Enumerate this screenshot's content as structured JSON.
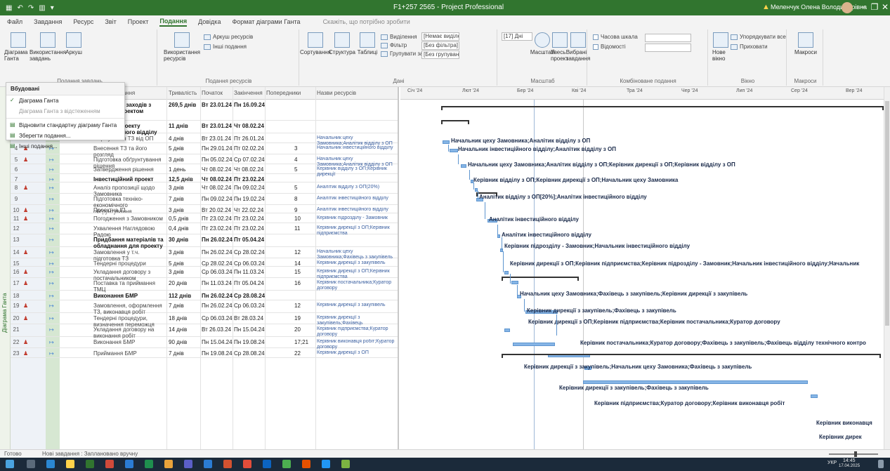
{
  "window": {
    "title": "F1+257 2565 - Project Professional",
    "user": "Меленчук Олена Володимирівна",
    "minimize": "−",
    "restore": "❐",
    "close": "✕"
  },
  "quick_access": [
    "▦",
    "↶",
    "↷",
    "▥",
    "▾"
  ],
  "tabs": [
    {
      "label": "Файл"
    },
    {
      "label": "Завдання"
    },
    {
      "label": "Ресурс"
    },
    {
      "label": "Звіт"
    },
    {
      "label": "Проект"
    },
    {
      "label": "Подання",
      "active": true
    },
    {
      "label": "Довідка"
    },
    {
      "label": "Формат діаграми Ганта"
    }
  ],
  "search_placeholder": "Скажіть, що потрібно зробити",
  "ribbon": {
    "groups": [
      {
        "label": "Подання завдань",
        "buttons": [
          "Діаграма Ганта",
          "Використання завдань",
          "Аркуш"
        ]
      },
      {
        "label": "Подання ресурсів",
        "buttons": [
          "Використання ресурсів",
          "Аркуш ресурсів",
          "Інші подання"
        ]
      },
      {
        "label": "Дані",
        "buttons": [
          "Сортування",
          "Структура",
          "Таблиці",
          "Виділення",
          "Фільтр",
          "Групувати за"
        ]
      },
      {
        "label": "Масштаб",
        "buttons": [
          "Масштаб",
          "Увесь проект",
          "Вибрані завдання"
        ]
      },
      {
        "label": "Комбіноване подання",
        "buttons": [
          "Часова шкала",
          "Відомості"
        ]
      },
      {
        "label": "Вікно",
        "buttons": [
          "Нове вікно",
          "Упорядкувати все",
          "Приховати"
        ]
      },
      {
        "label": "Макроси",
        "buttons": [
          "Макроси"
        ]
      }
    ],
    "combos": {
      "highlight": "[Немає виділення]",
      "filter": "[Без фільтра]",
      "group": "[Без групування]",
      "timescale": "[17] Дні"
    }
  },
  "dropdown": {
    "header": "Вбудовані",
    "items": [
      {
        "label": "Діаграма Ганта",
        "checked": true
      },
      {
        "label": "Діаграма Ганта з відстеженням",
        "muted": true
      },
      {
        "label": "Відновити стандартну діаграму Ганта"
      },
      {
        "label": "Зберегти подання..."
      },
      {
        "label": "Інші подання..."
      }
    ]
  },
  "side_label": "Діаграма Ганта",
  "grid": {
    "columns": [
      "Назва завдання",
      "Тривалість",
      "Початок",
      "Закінчення",
      "Попередники",
      "Назви ресурсів"
    ],
    "rows": [
      {
        "num": "",
        "name": "Тривалість заходів з робіт за проектом",
        "dur": "269,5 днів",
        "start": "Вт 23.01.24",
        "fin": "Пн 16.09.24",
        "pred": "",
        "res": "",
        "summary": true
      },
      {
        "num": "",
        "name": "Ініціація проекту інвестиційного відділу",
        "dur": "11 днів",
        "start": "Вт 23.01.24",
        "fin": "Чт 08.02.24",
        "pred": "",
        "res": "",
        "summary": true
      },
      {
        "num": "",
        "name": "Формування ТЗ від ОП",
        "dur": "4 днів",
        "start": "Вт 23.01.24",
        "fin": "Пт 26.01.24",
        "pred": "",
        "res": "Начальник цеху Замовника;Аналітик відділу з ОП",
        "summary": false
      },
      {
        "num": "4",
        "name": "Внесення ТЗ та його розгляд",
        "dur": "5 днів",
        "start": "Пн 29.01.24",
        "fin": "Пт 02.02.24",
        "pred": "3",
        "res": "Начальник інвестиційного відділу",
        "summary": false
      },
      {
        "num": "5",
        "name": "Підготовка обґрунтування рішення",
        "dur": "3 днів",
        "start": "Пн 05.02.24",
        "fin": "Ср 07.02.24",
        "pred": "4",
        "res": "Начальник цеху Замовника;Аналітик відділу з ОП",
        "summary": false
      },
      {
        "num": "6",
        "name": "Затвердження рішення",
        "dur": "1 день",
        "start": "Чт 08.02.24",
        "fin": "Чт 08.02.24",
        "pred": "5",
        "res": "Керівник відділу з ОП;Керівник дирекції",
        "summary": false
      },
      {
        "num": "7",
        "name": "Інвестиційний проект",
        "dur": "12,5 днів",
        "start": "Чт 08.02.24",
        "fin": "Пт 23.02.24",
        "pred": "",
        "res": "",
        "summary": true
      },
      {
        "num": "8",
        "name": "Аналіз пропозиції щодо Замовника",
        "dur": "3 днів",
        "start": "Чт 08.02.24",
        "fin": "Пн 09.02.24",
        "pred": "5",
        "res": "Аналітик відділу з ОП(20%)",
        "summary": false
      },
      {
        "num": "9",
        "name": "Підготовка техніко-економічного обґрунтування",
        "dur": "7 днів",
        "start": "Пн 09.02.24",
        "fin": "Пн 19.02.24",
        "pred": "8",
        "res": "Аналітик інвестиційного відділу",
        "summary": false
      },
      {
        "num": "10",
        "name": "Проектна ІП",
        "dur": "3 днів",
        "start": "Вт 20.02.24",
        "fin": "Чт 22.02.24",
        "pred": "9",
        "res": "Аналітик інвестиційного відділу",
        "summary": false
      },
      {
        "num": "11",
        "name": "Погодження з Замовником",
        "dur": "0,5 днів",
        "start": "Пт 23.02.24",
        "fin": "Пт 23.02.24",
        "pred": "10",
        "res": "Керівник підрозділу - Замовник",
        "summary": false
      },
      {
        "num": "12",
        "name": "Ухвалення Наглядовою Радою",
        "dur": "0,4 днів",
        "start": "Пт 23.02.24",
        "fin": "Пт 23.02.24",
        "pred": "11",
        "res": "Керівник дирекції з ОП;Керівник підприємства",
        "summary": false
      },
      {
        "num": "13",
        "name": "Придбання матеріалів та обладнання для проекту",
        "dur": "30 днів",
        "start": "Пн 26.02.24",
        "fin": "Пт 05.04.24",
        "pred": "",
        "res": "",
        "summary": true
      },
      {
        "num": "14",
        "name": "Замовлення у т.ч. підготовка ТЗ",
        "dur": "3 днів",
        "start": "Пн 26.02.24",
        "fin": "Ср 28.02.24",
        "pred": "12",
        "res": "Начальник цеху Замовника;Фахівець з закупівель",
        "summary": false
      },
      {
        "num": "15",
        "name": "Тендерні процедури",
        "dur": "5 днів",
        "start": "Ср 28.02.24",
        "fin": "Ср 06.03.24",
        "pred": "14",
        "res": "Керівник дирекції з закупівель",
        "summary": false
      },
      {
        "num": "16",
        "name": "Укладання договору з постачальником",
        "dur": "3 днів",
        "start": "Ср 06.03.24",
        "fin": "Пн 11.03.24",
        "pred": "15",
        "res": "Керівник дирекції з ОП;Керівник підприємства",
        "summary": false
      },
      {
        "num": "17",
        "name": "Поставка та приймання ТМЦ",
        "dur": "20 днів",
        "start": "Пн 11.03.24",
        "fin": "Пт 05.04.24",
        "pred": "16",
        "res": "Керівник постачальника;Куратор договору",
        "summary": false
      },
      {
        "num": "18",
        "name": "Виконання БМР",
        "dur": "112 днів",
        "start": "Пн 26.02.24",
        "fin": "Ср 28.08.24",
        "pred": "",
        "res": "",
        "summary": true
      },
      {
        "num": "19",
        "name": "Замовлення, оформлення ТЗ, виконавця робіт",
        "dur": "7 днів",
        "start": "Пн 26.02.24",
        "fin": "Ср 06.03.24",
        "pred": "12",
        "res": "Керівник дирекції з закупівель",
        "summary": false
      },
      {
        "num": "20",
        "name": "Тендерні процедури, визначення переможця",
        "dur": "18 днів",
        "start": "Ср 06.03.24",
        "fin": "Вт 28.03.24",
        "pred": "19",
        "res": "Керівник дирекції з закупівель;Фахівець",
        "summary": false
      },
      {
        "num": "21",
        "name": "Укладання договору на виконання робіт",
        "dur": "14 днів",
        "start": "Вт 26.03.24",
        "fin": "Пн 15.04.24",
        "pred": "20",
        "res": "Керівник підприємства;Куратор договору",
        "summary": false
      },
      {
        "num": "22",
        "name": "Виконання БМР",
        "dur": "90 днів",
        "start": "Пн 15.04.24",
        "fin": "Пн 19.08.24",
        "pred": "17;21",
        "res": "Керівник виконавця робіт;Куратор договору",
        "summary": false
      },
      {
        "num": "23",
        "name": "Приймання БМР",
        "dur": "7 днів",
        "start": "Пн 19.08.24",
        "fin": "Ср 28.08.24",
        "pred": "22",
        "res": "Керівник дирекції з ОП",
        "summary": false
      }
    ]
  },
  "gantt": {
    "timescale": [
      "Січ '24",
      "Лют '24",
      "Бер '24",
      "Кві '24",
      "Тра '24",
      "Чер '24",
      "Лип '24",
      "Сер '24",
      "Вер '24"
    ],
    "labels": [
      "Начальник цеху Замовника;Аналітик відділу з ОП",
      "Начальник інвестиційного відділу;Аналітик відділу з ОП",
      "Начальник цеху Замовника;Аналітик відділу з ОП;Керівник дирекції з ОП;Керівник відділу з ОП",
      "Керівник відділу з ОП;Керівник дирекції з ОП;Начальник цеху Замовника",
      "Аналітик відділу з ОП[20%];Аналітик інвестиційного відділу",
      "Аналітик інвестиційного відділу",
      "Аналітик інвестиційного відділу",
      "Керівник підрозділу - Замовник;Начальник інвестиційного відділу",
      "Керівник дирекції з ОП;Керівник підприємства;Керівник підрозділу - Замовник;Начальник інвестиційного відділу;Начальник",
      "Начальник цеху Замовника;Фахівець з закупівель;Керівник дирекції з закупівель",
      "Керівник дирекції з закупівель;Фахівець з закупівель",
      "Керівник дирекції з ОП;Керівник підприємства;Керівник постачальника;Куратор договору",
      "Керівник постачальника;Куратор договору;Фахівець з закупівель;Фахівець відділу технічного контро",
      "Керівник дирекції з закупівель;Начальник цеху Замовника;Фахівець з закупівель",
      "Керівник дирекції з закупівель;Фахівець з закупівель",
      "Керівник підприємства;Куратор договору;Керівник виконавця робіт",
      "Керівник виконавця",
      "Керівник дирек"
    ]
  },
  "status": {
    "left": "Готово",
    "mid": "Нові завдання : Заплановано вручну"
  },
  "tray": {
    "lang": "УКР",
    "time": "14:45",
    "date": "17.04.2025"
  },
  "colors": {
    "accent": "#31752f",
    "bar": "#86b5e6"
  }
}
